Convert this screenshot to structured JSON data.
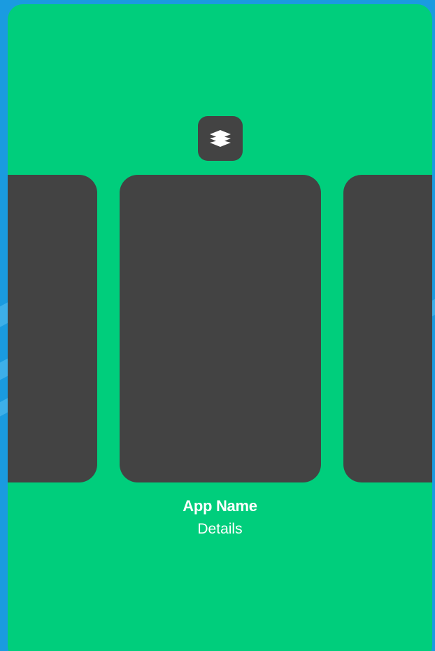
{
  "app": {
    "name": "App Name",
    "details": "Details",
    "icon": "layers-icon"
  },
  "carousel": {
    "cards": [
      "previous-card",
      "current-card",
      "next-card"
    ]
  },
  "colors": {
    "background": "#1a9be0",
    "panel": "#00ce7c",
    "card": "#434343",
    "text": "#ffffff"
  }
}
